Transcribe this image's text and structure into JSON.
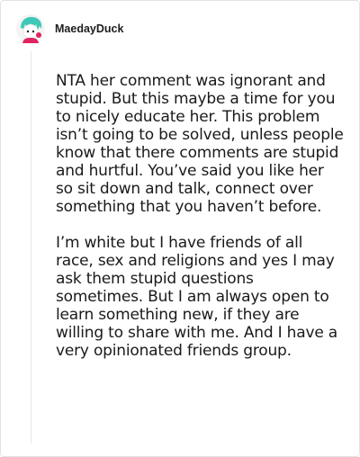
{
  "comment": {
    "username": "MaedayDuck",
    "paragraphs": [
      "NTA her comment was ignorant and stupid. But this maybe a time for you to nicely educate her. This problem isn’t going to be solved, unless people know that there comments are stupid and hurtful. You’ve said you like her so sit down and talk, connect over something that you haven’t before.",
      "I’m white but I have friends of all race, sex and religions and yes I may ask them stupid questions sometimes. But I am always open to learn something new, if they are willing to share with me. And I have a very opinionated friends group."
    ]
  },
  "colors": {
    "avatar_hair": "#3ec8b8",
    "avatar_accent": "#e0245e",
    "text": "#1a1a1b",
    "border": "#e3e3e3"
  }
}
